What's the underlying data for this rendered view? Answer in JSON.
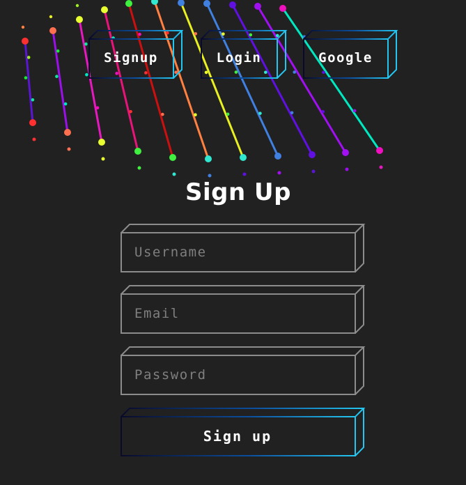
{
  "nav": {
    "signup_label": "Signup",
    "login_label": "Login",
    "google_label": "Google"
  },
  "form": {
    "title": "Sign Up",
    "username_placeholder": "Username",
    "email_placeholder": "Email",
    "password_placeholder": "Password",
    "submit_label": "Sign up"
  },
  "colors": {
    "background": "#212121",
    "gradient_start": "#0a0a2a",
    "gradient_mid": "#0b4f9f",
    "gradient_end": "#24c6f0",
    "field_border": "#8c8c8c",
    "placeholder_text": "#7f7f7f",
    "strand_colors": [
      "#5a16d0",
      "#9b10e8",
      "#e818c0",
      "#e8147a",
      "#cc1010",
      "#ff8040",
      "#e8f020",
      "#a0f020",
      "#10f030",
      "#10e8a0",
      "#00e8c0",
      "#f010c0",
      "#ff3030",
      "#ff7050",
      "#e8ff30",
      "#40f040",
      "#30e8d0",
      "#4080e0",
      "#6010e0",
      "#a010f0"
    ]
  }
}
